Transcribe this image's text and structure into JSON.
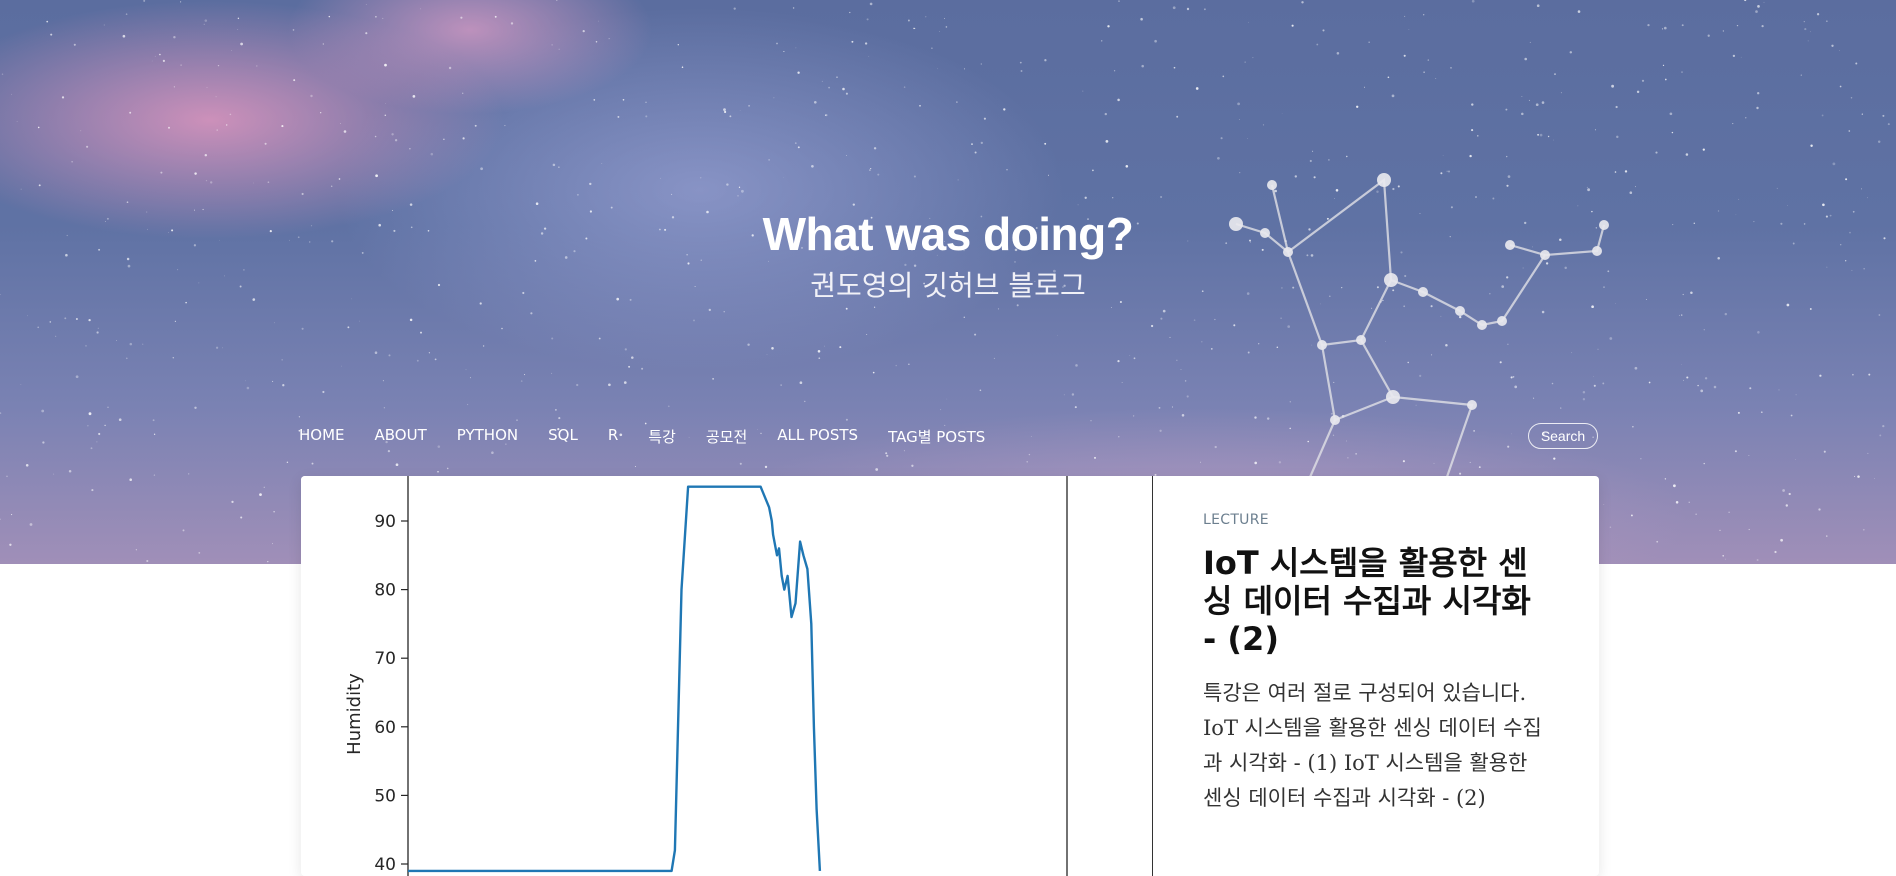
{
  "header": {
    "site_title": "What was doing?",
    "site_subtitle": "권도영의 깃허브 블로그"
  },
  "nav": {
    "items": [
      "HOME",
      "ABOUT",
      "PYTHON",
      "SQL",
      "R",
      "특강",
      "공모전",
      "ALL POSTS",
      "TAG별 POSTS"
    ],
    "search_label": "Search"
  },
  "post": {
    "category": "LECTURE",
    "title": "IoT 시스템을 활용한 센싱 데이터 수집과 시각화 - (2)",
    "excerpt": "특강은 여러 절로 구성되어 있습니다. IoT 시스템을 활용한 센싱 데이터 수집과 시각화 - (1) IoT 시스템을 활용한 센싱 데이터 수집과 시각화 - (2)"
  },
  "chart_data": {
    "type": "line",
    "ylabel": "Humidity",
    "xlabel": "",
    "title": "",
    "yticks": [
      90,
      80,
      70,
      60,
      50,
      40
    ],
    "ylim": [
      39,
      96
    ],
    "xlim": [
      0,
      100
    ],
    "series": [
      {
        "color": "#1f77b4",
        "x": [
          0,
          40,
          40.5,
          41.5,
          42.5,
          53.5,
          54.8,
          55.2,
          55.4,
          56,
          56.3,
          56.7,
          57.1,
          57.6,
          58.2,
          58.8,
          59.5,
          60,
          60.6,
          61.2,
          61.6,
          62,
          62.5
        ],
        "y": [
          39,
          39,
          42,
          80,
          95,
          95,
          92,
          90,
          88,
          85,
          86,
          82,
          80,
          82,
          76,
          78,
          87,
          85,
          83,
          75,
          60,
          48,
          39
        ]
      }
    ],
    "line_color": "#1f77b4"
  }
}
